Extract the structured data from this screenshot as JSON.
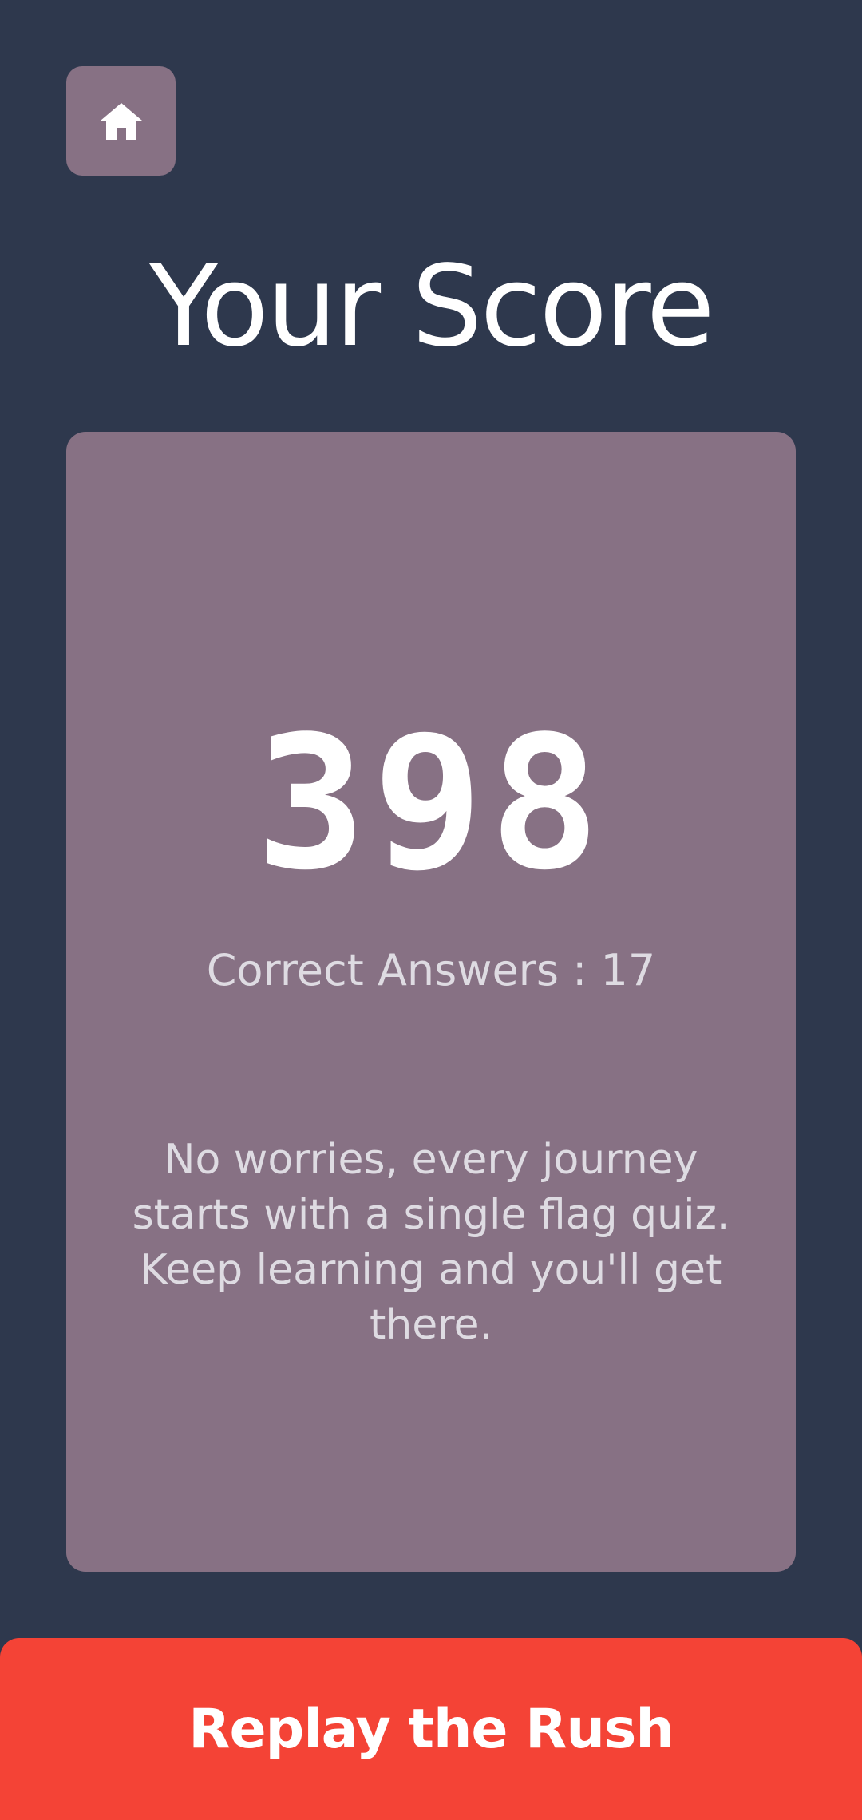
{
  "header": {
    "home_icon": "home-icon",
    "title": "Your Score"
  },
  "card": {
    "score": "398",
    "correct_answers": "Correct Answers : 17",
    "message": "No worries, every journey starts with a single flag quiz. Keep learning and you'll get there."
  },
  "footer": {
    "replay_label": "Replay the Rush"
  },
  "colors": {
    "background": "#2e384d",
    "card": "#877184",
    "accent": "#f44336",
    "secondary_text": "#dedbe2"
  }
}
